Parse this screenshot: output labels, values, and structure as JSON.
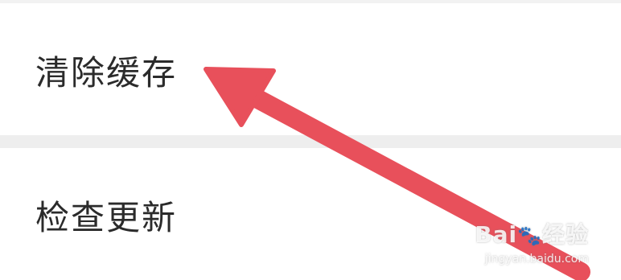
{
  "settings": {
    "items": [
      {
        "label": "清除缓存"
      },
      {
        "label": "检查更新"
      }
    ]
  },
  "annotation": {
    "arrow_color": "#e8505b"
  },
  "watermark": {
    "brand": "Bai",
    "brand_suffix": "经验",
    "url": "jingyan.baidu.com",
    "icon": "paw-icon"
  }
}
